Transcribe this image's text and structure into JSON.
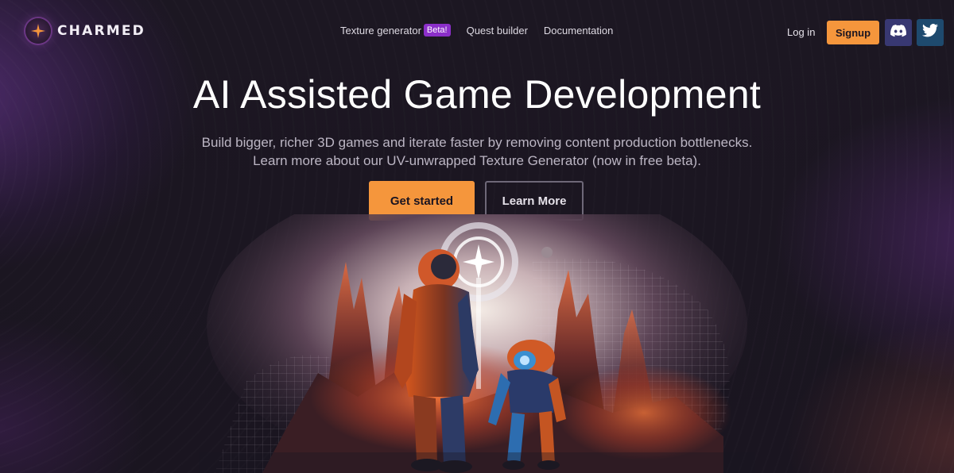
{
  "brand": {
    "name": "CHARMED",
    "logo_icon": "four-point-star-icon",
    "accent": "#f5963c"
  },
  "nav": {
    "links": [
      {
        "label": "Texture generator",
        "badge": "Beta!"
      },
      {
        "label": "Quest builder"
      },
      {
        "label": "Documentation"
      }
    ],
    "login_label": "Log in",
    "signup_label": "Signup",
    "social": [
      {
        "icon": "discord-icon",
        "color": "#383872"
      },
      {
        "icon": "twitter-icon",
        "color": "#1e4a6e"
      }
    ]
  },
  "hero": {
    "title": "AI Assisted Game Development",
    "subtitle_line1": "Build bigger, richer 3D games and iterate faster by removing content production bottlenecks.",
    "subtitle_line2": "Learn more about our UV-unwrapped Texture Generator (now in free beta).",
    "primary_cta": "Get started",
    "secondary_cta": "Learn More"
  },
  "illustration": {
    "subject": "astronaut-and-robot-on-alien-landscape"
  }
}
